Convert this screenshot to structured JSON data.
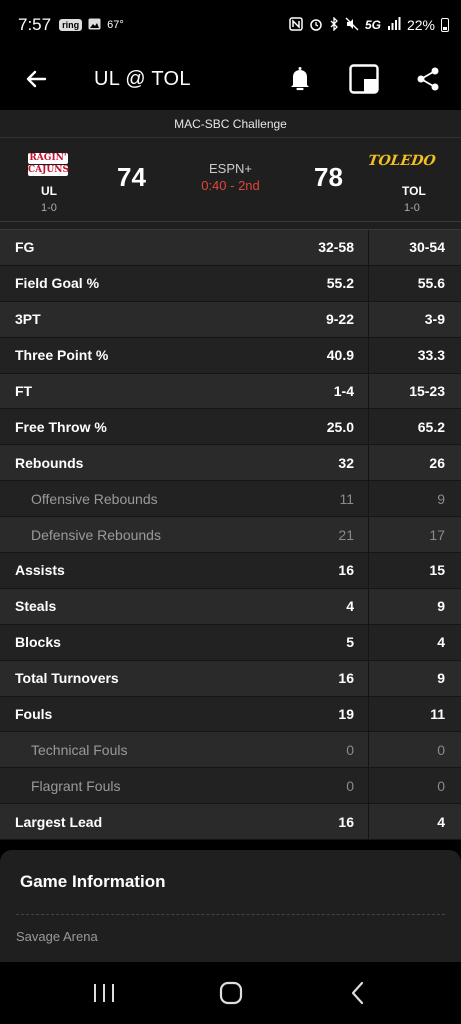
{
  "status_bar": {
    "time": "7:57",
    "temperature": "67°",
    "network": "5G",
    "battery": "22%",
    "left_icons": [
      "ring-icon",
      "image-icon"
    ],
    "right_icons": [
      "nfc-icon",
      "alarm-icon",
      "bluetooth-icon",
      "mute-icon",
      "signal-icon",
      "battery-icon"
    ]
  },
  "app_bar": {
    "title": "UL @ TOL",
    "actions": [
      "bell-icon",
      "picture-in-picture-icon",
      "share-icon"
    ]
  },
  "game": {
    "event": "MAC-SBC Challenge",
    "home": {
      "logo_lines": [
        "RAGIN'",
        "CAJUNS"
      ],
      "abbr": "UL",
      "record": "1-0",
      "score": "74"
    },
    "away": {
      "logo_text": "TOLEDO",
      "abbr": "TOL",
      "record": "1-0",
      "score": "78"
    },
    "network": "ESPN+",
    "clock": "0:40 - 2nd"
  },
  "stats": [
    {
      "label": "FG",
      "ul": "32-58",
      "tol": "30-54",
      "sub": false
    },
    {
      "label": "Field Goal %",
      "ul": "55.2",
      "tol": "55.6",
      "sub": false
    },
    {
      "label": "3PT",
      "ul": "9-22",
      "tol": "3-9",
      "sub": false
    },
    {
      "label": "Three Point %",
      "ul": "40.9",
      "tol": "33.3",
      "sub": false
    },
    {
      "label": "FT",
      "ul": "1-4",
      "tol": "15-23",
      "sub": false
    },
    {
      "label": "Free Throw %",
      "ul": "25.0",
      "tol": "65.2",
      "sub": false
    },
    {
      "label": "Rebounds",
      "ul": "32",
      "tol": "26",
      "sub": false
    },
    {
      "label": "Offensive Rebounds",
      "ul": "11",
      "tol": "9",
      "sub": true
    },
    {
      "label": "Defensive Rebounds",
      "ul": "21",
      "tol": "17",
      "sub": true
    },
    {
      "label": "Assists",
      "ul": "16",
      "tol": "15",
      "sub": false
    },
    {
      "label": "Steals",
      "ul": "4",
      "tol": "9",
      "sub": false
    },
    {
      "label": "Blocks",
      "ul": "5",
      "tol": "4",
      "sub": false
    },
    {
      "label": "Total Turnovers",
      "ul": "16",
      "tol": "9",
      "sub": false
    },
    {
      "label": "Fouls",
      "ul": "19",
      "tol": "11",
      "sub": false
    },
    {
      "label": "Technical Fouls",
      "ul": "0",
      "tol": "0",
      "sub": true
    },
    {
      "label": "Flagrant Fouls",
      "ul": "0",
      "tol": "0",
      "sub": true
    },
    {
      "label": "Largest Lead",
      "ul": "16",
      "tol": "4",
      "sub": false
    }
  ],
  "game_information": {
    "title": "Game Information",
    "venue": "Savage Arena"
  },
  "nav_bar": [
    "recent-apps-icon",
    "home-icon",
    "back-icon"
  ],
  "colors": {
    "clock": "#e0463a",
    "ul_red": "#c8102e",
    "toledo_gold": "#f3c022"
  }
}
